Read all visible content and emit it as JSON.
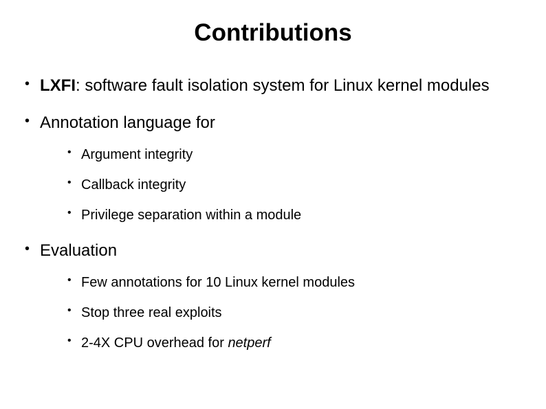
{
  "title": "Contributions",
  "items": [
    {
      "bold": "LXFI",
      "text": ": software fault isolation system for Linux kernel modules"
    },
    {
      "text": "Annotation language for",
      "sub": [
        "Argument integrity",
        "Callback integrity",
        "Privilege separation within a module"
      ]
    },
    {
      "text": "Evaluation",
      "sub": [
        "Few annotations for 10 Linux kernel modules",
        "Stop three real exploits"
      ],
      "subLast": {
        "pre": "2-4X CPU overhead for ",
        "italic": "netperf"
      }
    }
  ]
}
